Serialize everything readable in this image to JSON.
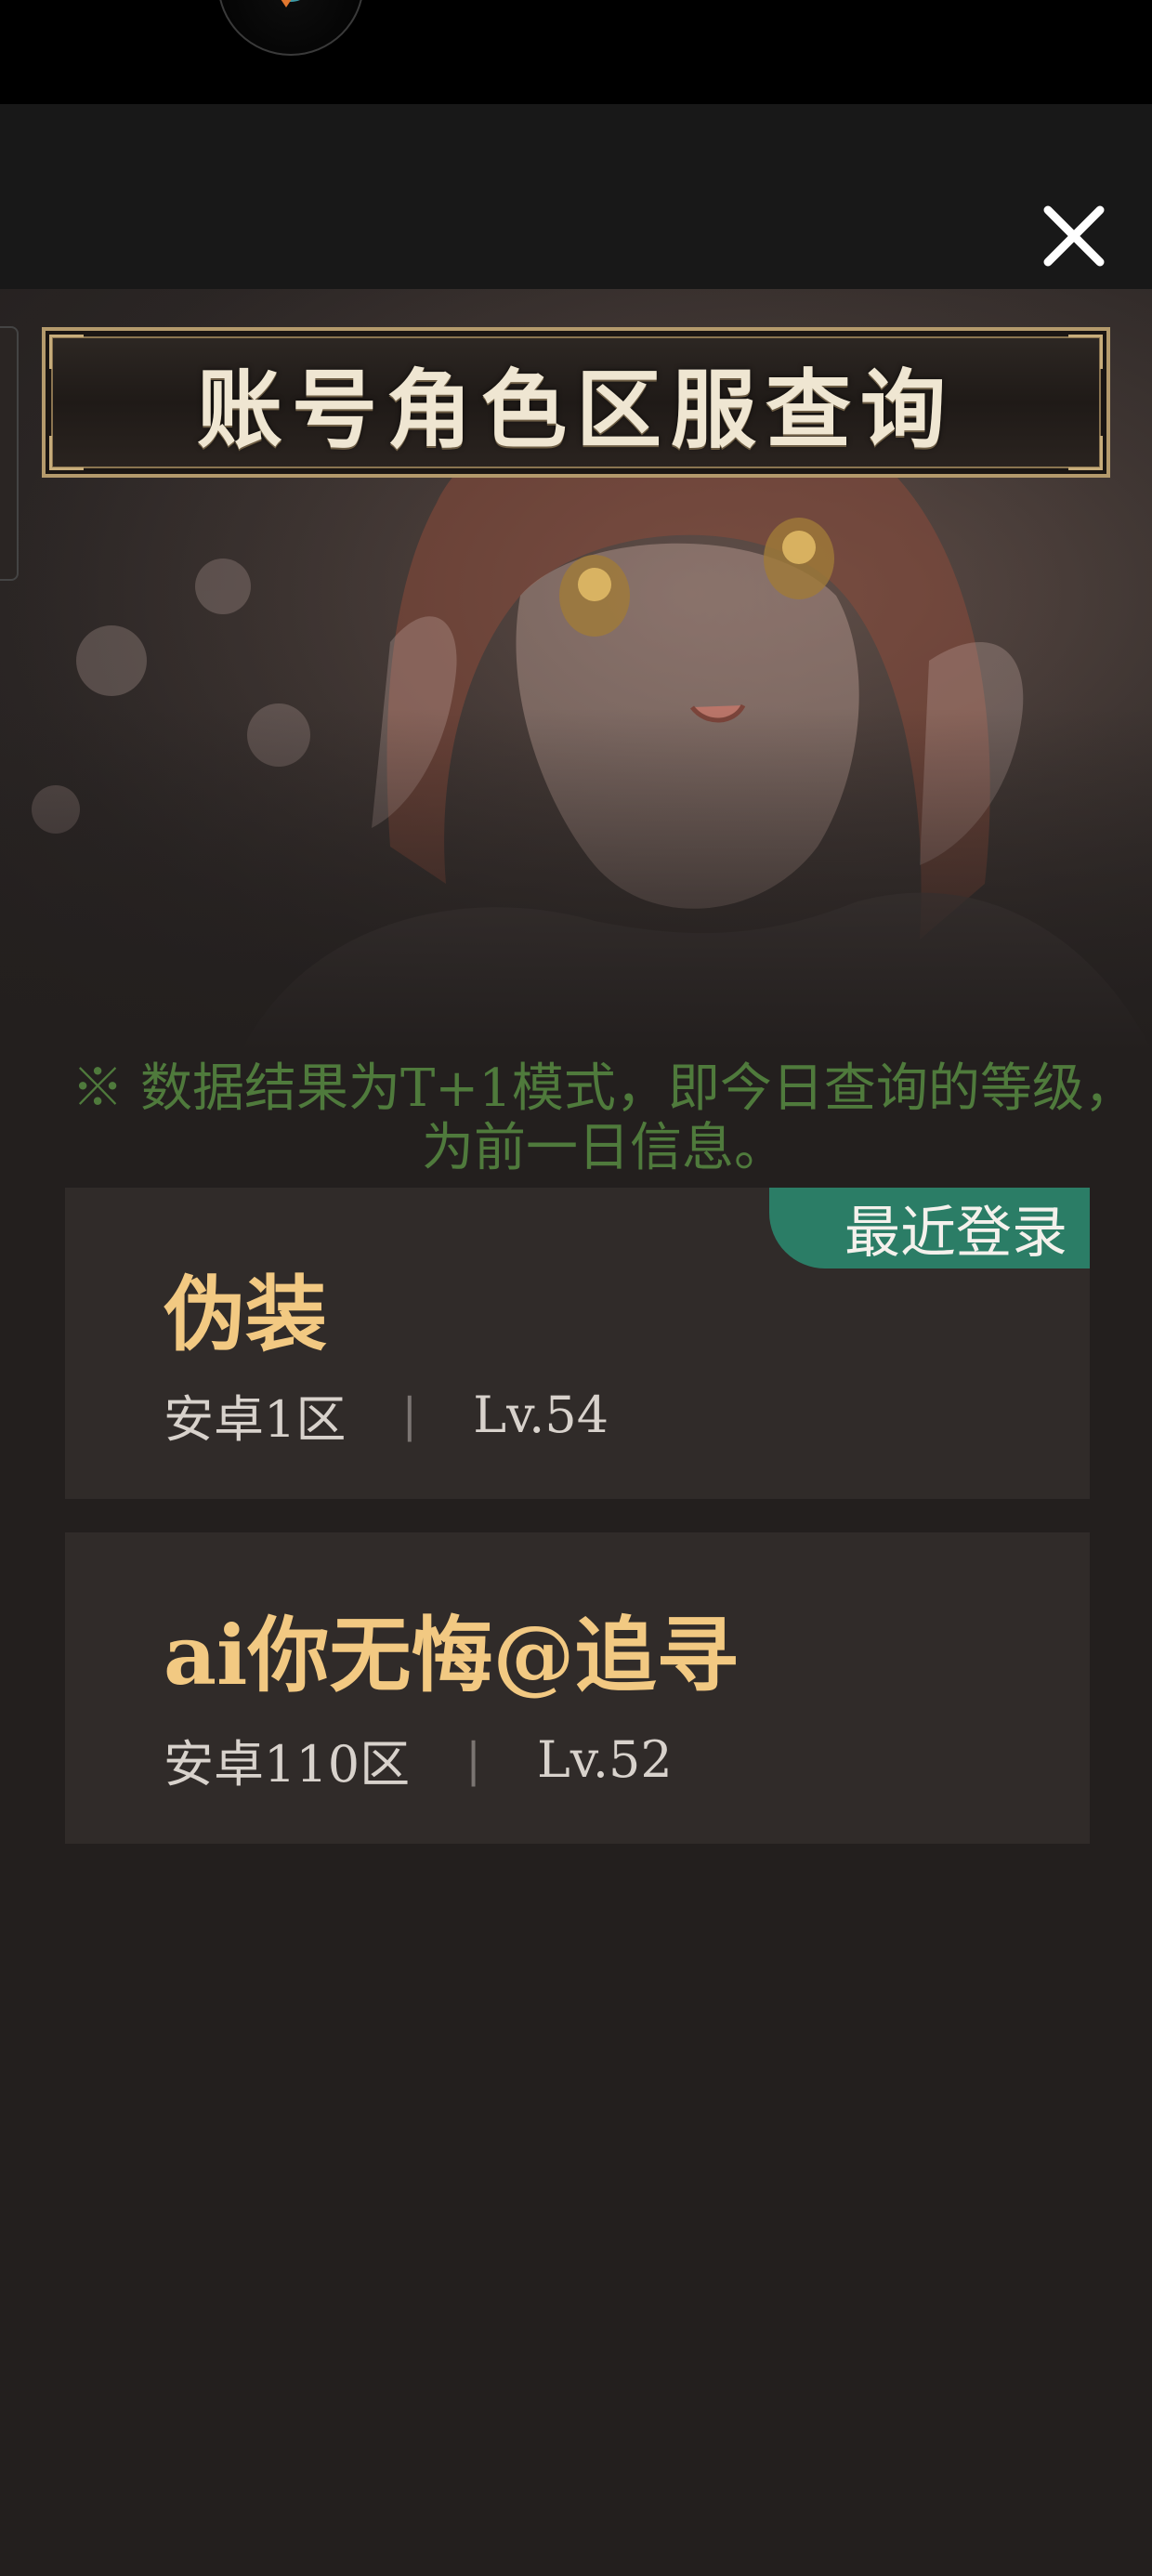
{
  "page": {
    "title": "账号角色区服查询",
    "notice": "※ 数据结果为T+1模式，即今日查询的等级，为前一日信息。"
  },
  "roles": [
    {
      "name": "伪装",
      "server": "安卓1区",
      "level": "Lv.54",
      "badge": "最近登录"
    },
    {
      "name": "ai你无悔@追寻",
      "server": "安卓110区",
      "level": "Lv.52"
    }
  ],
  "colors": {
    "name": "#f2c982",
    "notice": "#4f7a3c",
    "badge": "#2b7d66",
    "card": "#302b29",
    "background": "#231f1e"
  },
  "icons": {
    "close": "close-icon",
    "avatar": "bird-avatar-icon"
  }
}
